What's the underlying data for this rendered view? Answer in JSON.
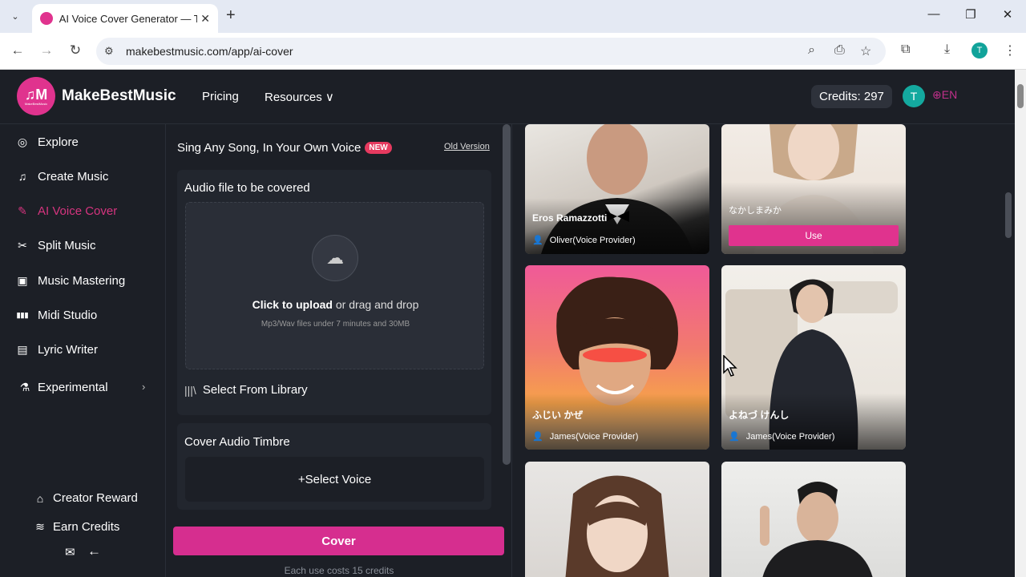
{
  "browser": {
    "tab_title": "AI Voice Cover Generator — Tra",
    "url": "makebestmusic.com/app/ai-cover",
    "profile_initial": "T"
  },
  "header": {
    "brand": "MakeBestMusic",
    "logo_caption": "MakeBestMusic",
    "nav": {
      "pricing": "Pricing",
      "resources": "Resources"
    },
    "credits": "Credits: 297",
    "avatar_initial": "T",
    "language": "EN"
  },
  "sidebar": {
    "items": [
      {
        "label": "Explore",
        "icon": "compass-icon"
      },
      {
        "label": "Create Music",
        "icon": "music-note-icon"
      },
      {
        "label": "AI Voice Cover",
        "icon": "brush-icon",
        "active": true
      },
      {
        "label": "Split Music",
        "icon": "split-icon"
      },
      {
        "label": "Music Mastering",
        "icon": "mastering-icon"
      },
      {
        "label": "Midi Studio",
        "icon": "midi-icon"
      },
      {
        "label": "Lyric Writer",
        "icon": "document-icon"
      },
      {
        "label": "Experimental",
        "icon": "flask-icon"
      }
    ],
    "footer": {
      "reward": "Creator Reward",
      "earn": "Earn Credits"
    }
  },
  "panel": {
    "title": "Sing Any Song, In Your Own Voice",
    "badge": "NEW",
    "old_version": "Old Version",
    "audio_section": {
      "title": "Audio file to be covered",
      "upload_strong": "Click to upload",
      "upload_rest": " or drag and drop",
      "hint": "Mp3/Wav files under 7 minutes and 30MB",
      "library": "Select From Library"
    },
    "timbre_section": {
      "title": "Cover Audio Timbre",
      "select_voice": "+Select Voice"
    },
    "cover_button": "Cover",
    "cost_note": "Each use costs 15 credits"
  },
  "voices": [
    {
      "name": "Eros Ramazzotti",
      "provider": "Oliver(Voice Provider)"
    },
    {
      "name": "なかしまみか",
      "use_label": "Use"
    },
    {
      "name": "ふじい かぜ",
      "provider": "James(Voice Provider)"
    },
    {
      "name": "よねづ けんし",
      "provider": "James(Voice Provider)"
    }
  ],
  "colors": {
    "accent": "#e0338e",
    "background": "#1c1f26",
    "active_nav": "#d6347f"
  }
}
